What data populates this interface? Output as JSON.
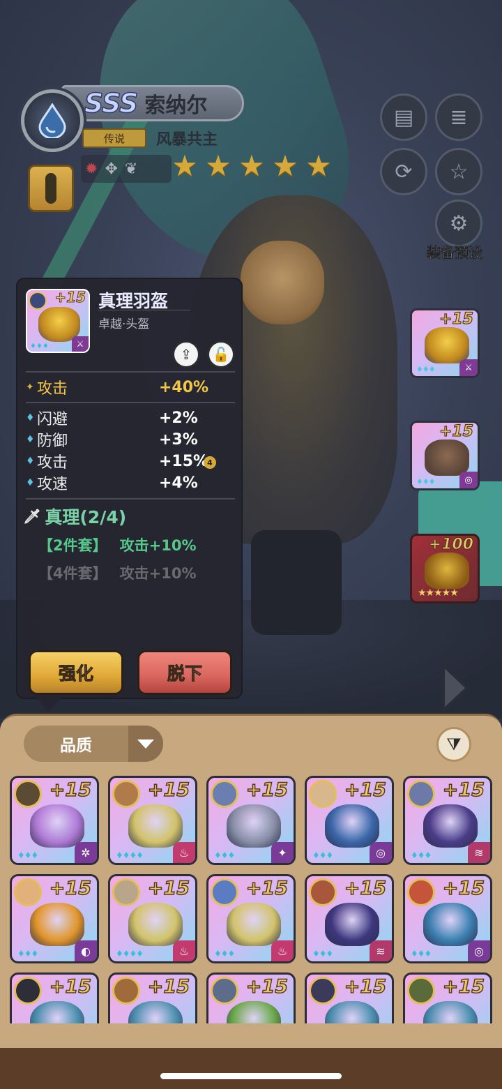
{
  "hero": {
    "rank": "SSS",
    "name": "索纳尔",
    "rarity": "传说",
    "title": "风暴共主",
    "star_count": 5,
    "class_icons": [
      "wolf-icon",
      "beast-icon",
      "nature-icon"
    ]
  },
  "side_buttons": {
    "preset_label": "装备预设"
  },
  "equipped": [
    {
      "plus": "+15",
      "art_color": "#e9b73a",
      "gems": "♦♦♦",
      "type_icon": "sword-icon"
    },
    {
      "plus": "+15",
      "art_color": "#5a4438",
      "gems": "♦♦♦",
      "type_icon": "ring-icon"
    },
    {
      "plus": "+100",
      "art_color": "#c99a25",
      "stars": "★★★★★"
    }
  ],
  "detail": {
    "plus": "+15",
    "item_name": "真理羽盔",
    "item_type": "卓越·头盔",
    "main_stat": {
      "label": "攻击",
      "value": "+40%"
    },
    "sub_stats": [
      {
        "label": "闪避",
        "value": "+2%"
      },
      {
        "label": "防御",
        "value": "+3%"
      },
      {
        "label": "攻击",
        "value": "+15%"
      },
      {
        "label": "攻速",
        "value": "+4%"
      }
    ],
    "sub_stat_mark": "4",
    "set_name": "真理(2/4)",
    "set_bonus_2": {
      "label": "【2件套】",
      "bonus": "攻击+10%"
    },
    "set_bonus_4": {
      "label": "【4件套】",
      "bonus": "攻击+10%"
    },
    "upgrade_label": "强化",
    "remove_label": "脱下"
  },
  "inventory": {
    "sort_label": "品质",
    "cards": [
      {
        "plus": "+15",
        "portrait": "#5b4a34",
        "art": "#b07ad6",
        "gems": "♦♦♦",
        "type": "#7a3a98",
        "type_icon": "✲"
      },
      {
        "plus": "+15",
        "portrait": "#b07a4a",
        "art": "#d2c36a",
        "gems": "♦♦♦♦",
        "type": "#c23a6e",
        "type_icon": "♨"
      },
      {
        "plus": "+15",
        "portrait": "#6a7fb0",
        "art": "#8a8fa8",
        "gems": "♦♦♦",
        "type": "#7a3a98",
        "type_icon": "✦"
      },
      {
        "plus": "+15",
        "portrait": "#d8b78c",
        "art": "#3a66a8",
        "gems": "♦♦♦",
        "type": "#7a3a98",
        "type_icon": "◎"
      },
      {
        "plus": "+15",
        "portrait": "#6d7aa8",
        "art": "#4a3c88",
        "gems": "♦♦♦",
        "type": "#b13a6a",
        "type_icon": "≋"
      },
      {
        "plus": "+15",
        "portrait": "#e2b07a",
        "art": "#e2962a",
        "gems": "♦♦♦",
        "type": "#7a3a98",
        "type_icon": "◐"
      },
      {
        "plus": "+15",
        "portrait": "#b9a68a",
        "art": "#d2c36a",
        "gems": "♦♦♦♦",
        "type": "#c23a6e",
        "type_icon": "♨"
      },
      {
        "plus": "+15",
        "portrait": "#5b7cc2",
        "art": "#d2c36a",
        "gems": "♦♦♦",
        "type": "#c23a6e",
        "type_icon": "♨"
      },
      {
        "plus": "+15",
        "portrait": "#a8563c",
        "art": "#3d367e",
        "gems": "♦♦♦",
        "type": "#b13a6a",
        "type_icon": "≋"
      },
      {
        "plus": "+15",
        "portrait": "#c4553a",
        "art": "#3b7fb0",
        "gems": "♦♦♦",
        "type": "#7a3a98",
        "type_icon": "◎"
      },
      {
        "plus": "+15",
        "portrait": "#2e2e3a",
        "art": "#4d8fb0",
        "gems": "",
        "type": "",
        "type_icon": ""
      },
      {
        "plus": "+15",
        "portrait": "#a06a3a",
        "art": "#4d8fb0",
        "gems": "",
        "type": "",
        "type_icon": ""
      },
      {
        "plus": "+15",
        "portrait": "#5c6c8a",
        "art": "#6aa84a",
        "gems": "",
        "type": "",
        "type_icon": ""
      },
      {
        "plus": "+15",
        "portrait": "#3b3a5a",
        "art": "#4d8fb0",
        "gems": "",
        "type": "",
        "type_icon": ""
      },
      {
        "plus": "+15",
        "portrait": "#5a6a3a",
        "art": "#4d8fb0",
        "gems": "",
        "type": "",
        "type_icon": ""
      }
    ]
  }
}
